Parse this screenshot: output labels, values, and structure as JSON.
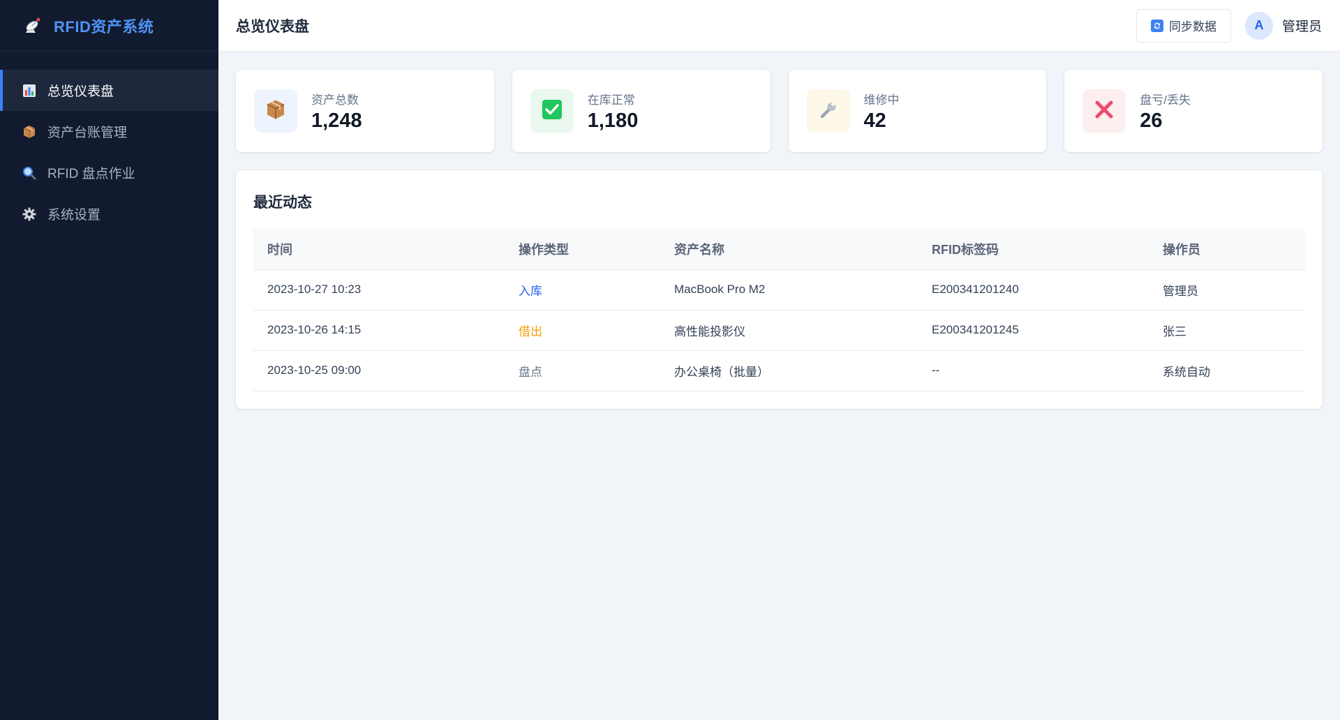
{
  "app": {
    "title": "RFID资产系统"
  },
  "sidebar": {
    "items": [
      {
        "label": "总览仪表盘",
        "icon": "bar-chart-icon",
        "active": true
      },
      {
        "label": "资产台账管理",
        "icon": "package-icon",
        "active": false
      },
      {
        "label": "RFID 盘点作业",
        "icon": "magnifier-icon",
        "active": false
      },
      {
        "label": "系统设置",
        "icon": "gear-icon",
        "active": false
      }
    ]
  },
  "header": {
    "title": "总览仪表盘",
    "sync_label": "同步数据",
    "avatar_initial": "A",
    "user_name": "管理员"
  },
  "stats": [
    {
      "label": "资产总数",
      "value": "1,248",
      "icon": "package-icon",
      "color": "#eef4fd"
    },
    {
      "label": "在库正常",
      "value": "1,180",
      "icon": "check-icon",
      "color": "#eaf8ef"
    },
    {
      "label": "维修中",
      "value": "42",
      "icon": "wrench-icon",
      "color": "#fdf8e7"
    },
    {
      "label": "盘亏/丢失",
      "value": "26",
      "icon": "cross-icon",
      "color": "#fdeef0"
    }
  ],
  "activity": {
    "title": "最近动态",
    "columns": [
      "时间",
      "操作类型",
      "资产名称",
      "RFID标签码",
      "操作员"
    ],
    "rows": [
      {
        "time": "2023-10-27 10:23",
        "type": "入库",
        "type_color": "#2563eb",
        "name": "MacBook Pro M2",
        "tag": "E200341201240",
        "operator": "管理员"
      },
      {
        "time": "2023-10-26 14:15",
        "type": "借出",
        "type_color": "#f59e0b",
        "name": "高性能投影仪",
        "tag": "E200341201245",
        "operator": "张三"
      },
      {
        "time": "2023-10-25 09:00",
        "type": "盘点",
        "type_color": "#64748b",
        "name": "办公桌椅（批量）",
        "tag": "--",
        "operator": "系统自动"
      }
    ]
  }
}
